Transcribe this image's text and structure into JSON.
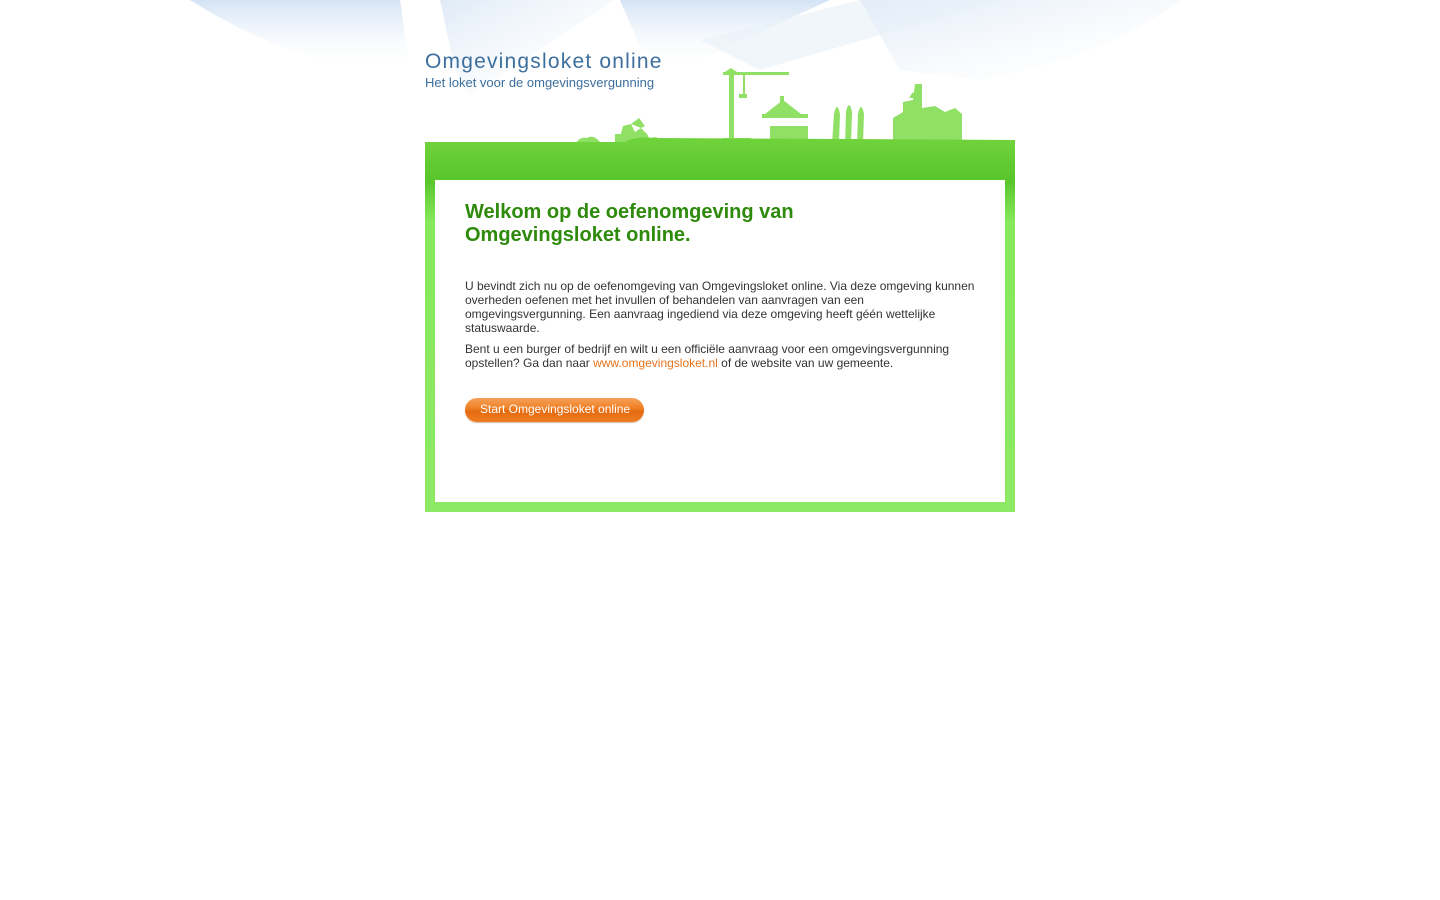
{
  "header": {
    "title": "Omgevingsloket online",
    "subtitle": "Het loket voor de omgevingsvergunning"
  },
  "main": {
    "heading": "Welkom op de oefenomgeving van Omgevingsloket online.",
    "paragraph1": "U bevindt zich nu op de oefenomgeving van Omgevingsloket online. Via deze omgeving kunnen overheden oefenen met het invullen of behandelen van aanvragen van een omgevingsvergunning. Een aanvraag ingediend via deze omgeving heeft géén wettelijke statuswaarde.",
    "paragraph2_before": "Bent u een burger of bedrijf en wilt u een officiële aanvraag voor een omgevingsvergunning opstellen? Ga dan naar ",
    "link_text": "www.omgevingsloket.nl",
    "paragraph2_after": " of de website van uw gemeente.",
    "start_button": "Start Omgevingsloket online"
  },
  "theme": {
    "title_color": "#3d6f9e",
    "heading_color": "#2e8a0b",
    "frame_green": "#8ce964",
    "link_color": "#e8731c",
    "button_color": "#ef7d22"
  },
  "icons": {
    "skyline": "city-skyline-illustration"
  }
}
